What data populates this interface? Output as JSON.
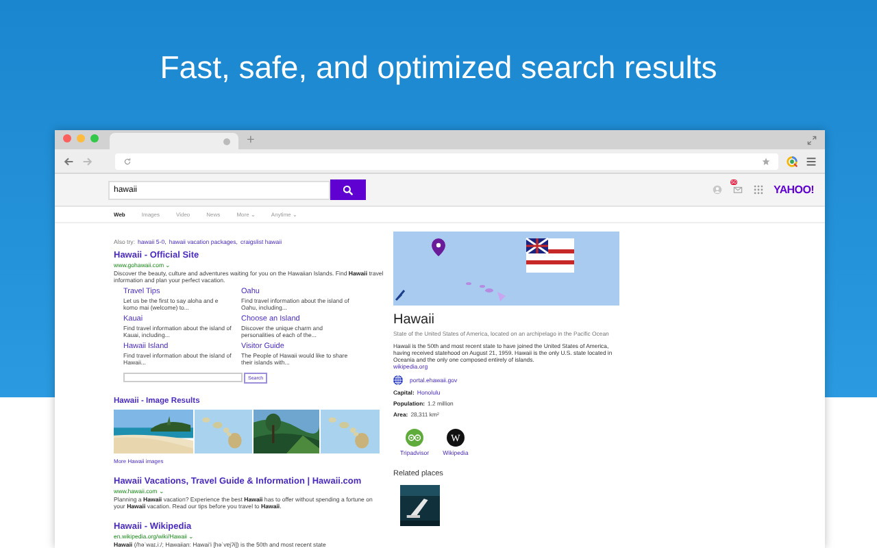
{
  "headline": "Fast, safe, and optimized search results",
  "browser": {
    "new_tab": "+",
    "notifications": "50",
    "logo": "YAHOO!"
  },
  "search": {
    "value": "hawaii"
  },
  "nav": [
    {
      "label": "Web",
      "selected": true
    },
    {
      "label": "Images",
      "selected": false
    },
    {
      "label": "Video",
      "selected": false
    },
    {
      "label": "News",
      "selected": false
    },
    {
      "label": "More ⌄",
      "selected": false
    },
    {
      "label": "Anytime ⌄",
      "selected": false
    }
  ],
  "also_try": {
    "label": "Also try:",
    "links": [
      "hawaii 5-0,",
      "hawaii vacation packages,",
      "craigslist hawaii"
    ]
  },
  "top_result": {
    "title": "Hawaii - Official Site",
    "url": "www.gohawaii.com ⌄",
    "description": "Discover the beauty, culture and adventures waiting for you on the Hawaiian Islands. Find **Hawaii** travel information and plan your perfect vacation.",
    "sitelinks": [
      {
        "title": "Travel Tips",
        "text": "Let us be the first to say aloha and e komo mai (welcome) to..."
      },
      {
        "title": "Oahu",
        "text": "Find travel information about the island of Oahu, including..."
      },
      {
        "title": "Kauai",
        "text": "Find travel information about the island of Kauai, including..."
      },
      {
        "title": "Choose an Island",
        "text": "Discover the unique charm and personalities of each of the..."
      },
      {
        "title": "Hawaii Island",
        "text": "Find travel information about the island of Hawaii..."
      },
      {
        "title": "Visitor Guide",
        "text": "The People of Hawaii would like to share their islands with..."
      }
    ],
    "site_search_button": "Search"
  },
  "image_results": {
    "title": "Hawaii - Image Results",
    "more": "More Hawaii images"
  },
  "results": [
    {
      "title": "Hawaii Vacations, Travel Guide & Information | Hawaii.com",
      "url": "www.hawaii.com ⌄",
      "description": "Planning a **Hawaii** vacation? Experience the best **Hawaii** has to offer without spending a fortune on your **Hawaii** vacation. Read our tips before you travel to **Hawaii**."
    },
    {
      "title": "Hawaii - Wikipedia",
      "url": "en.wikipedia.org/wiki/Hawaii ⌄",
      "description": "**Hawaii** (/həˈwaɪ.iː/; Hawaiian: Hawaiʻi [həˈvɐjʔi]) is the 50th and most recent state"
    }
  ],
  "knowledge": {
    "title": "Hawaii",
    "subtitle": "State of the United States of America, located on an archipelago in the Pacific Ocean",
    "summary": "Hawaii is the 50th and most recent state to have joined the United States of America, having received statehood on August 21, 1959. Hawaii is the only U.S. state located in Oceania and the only one composed entirely of islands.",
    "source": "wikipedia.org",
    "website": "portal.ehawaii.gov",
    "facts": [
      {
        "label": "Capital:",
        "value": "Honolulu",
        "link": true
      },
      {
        "label": "Population:",
        "value": "1.2 million",
        "link": false
      },
      {
        "label": "Area:",
        "value": "28,311 km²",
        "link": false
      }
    ],
    "profiles": [
      {
        "kind": "tripadvisor",
        "label": "Tripadvisor"
      },
      {
        "kind": "wikipedia",
        "glyph": "W",
        "label": "Wikipedia"
      }
    ],
    "related_title": "Related places"
  }
}
